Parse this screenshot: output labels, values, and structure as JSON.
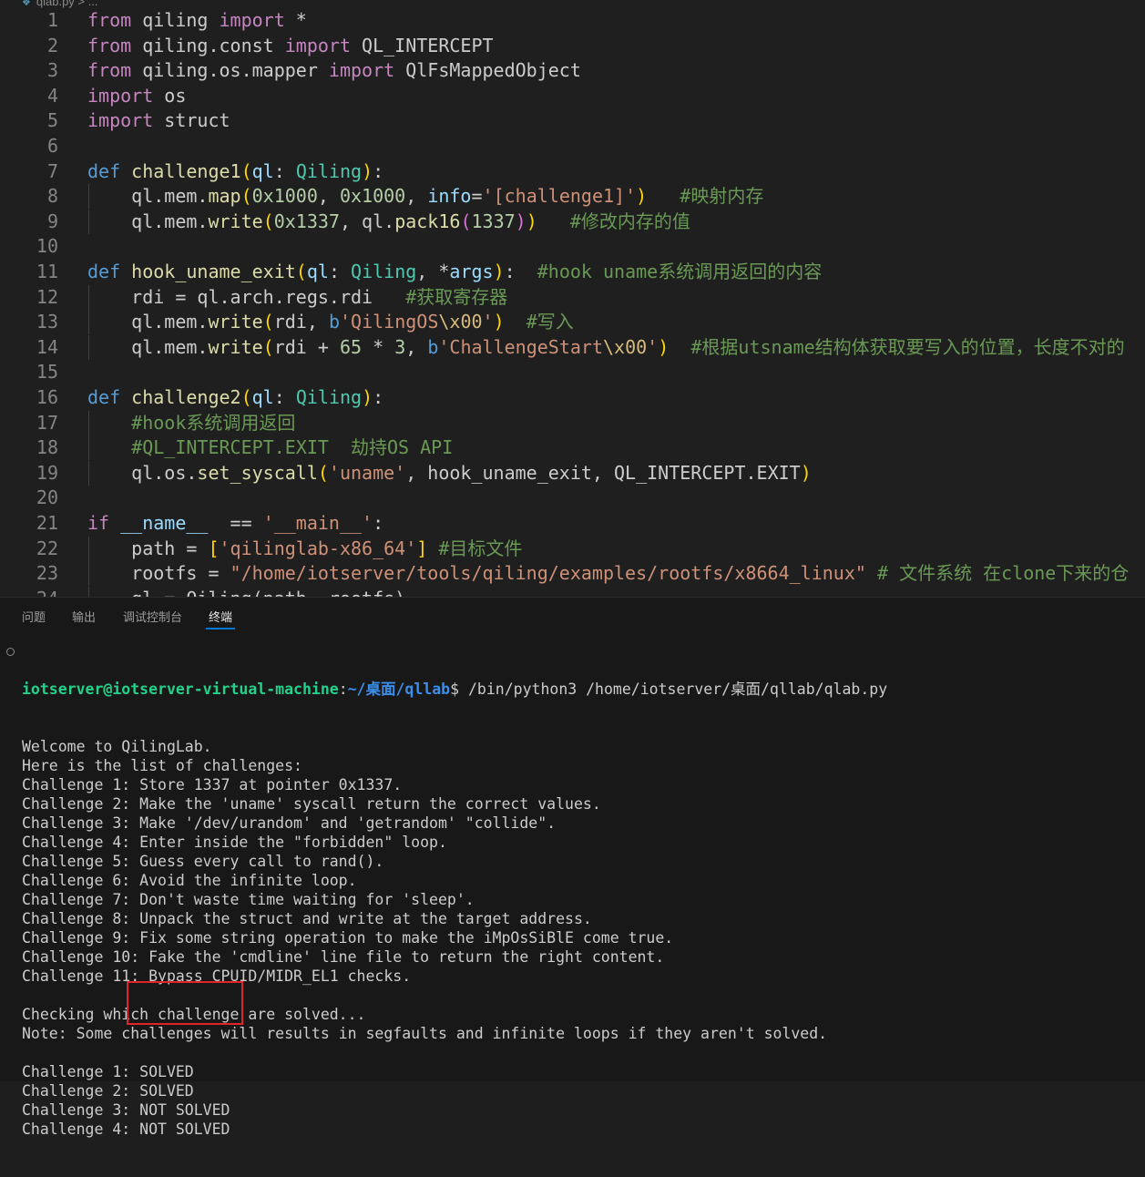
{
  "editor": {
    "breadcrumb": "qlab.py > ...",
    "lines": [
      {
        "n": "1",
        "tokens": [
          [
            "kw-ctrl",
            "from"
          ],
          [
            "txt",
            " qiling "
          ],
          [
            "kw-ctrl",
            "import"
          ],
          [
            "txt",
            " *"
          ]
        ]
      },
      {
        "n": "2",
        "tokens": [
          [
            "kw-ctrl",
            "from"
          ],
          [
            "txt",
            " qiling.const "
          ],
          [
            "kw-ctrl",
            "import"
          ],
          [
            "txt",
            " QL_INTERCEPT"
          ]
        ]
      },
      {
        "n": "3",
        "tokens": [
          [
            "kw-ctrl",
            "from"
          ],
          [
            "txt",
            " qiling.os.mapper "
          ],
          [
            "kw-ctrl",
            "import"
          ],
          [
            "txt",
            " QlFsMappedObject"
          ]
        ]
      },
      {
        "n": "4",
        "tokens": [
          [
            "kw-ctrl",
            "import"
          ],
          [
            "txt",
            " os"
          ]
        ]
      },
      {
        "n": "5",
        "tokens": [
          [
            "kw-ctrl",
            "import"
          ],
          [
            "txt",
            " struct"
          ]
        ]
      },
      {
        "n": "6",
        "tokens": []
      },
      {
        "n": "7",
        "tokens": [
          [
            "kw",
            "def"
          ],
          [
            "txt",
            " "
          ],
          [
            "fn",
            "challenge1"
          ],
          [
            "b1",
            "("
          ],
          [
            "var",
            "ql"
          ],
          [
            "txt",
            ": "
          ],
          [
            "cls",
            "Qiling"
          ],
          [
            "b1",
            ")"
          ],
          [
            "txt",
            ":"
          ]
        ]
      },
      {
        "n": "8",
        "indent": true,
        "tokens": [
          [
            "txt",
            "    ql.mem."
          ],
          [
            "fn",
            "map"
          ],
          [
            "b1",
            "("
          ],
          [
            "num",
            "0x1000"
          ],
          [
            "txt",
            ", "
          ],
          [
            "num",
            "0x1000"
          ],
          [
            "txt",
            ", "
          ],
          [
            "var",
            "info"
          ],
          [
            "txt",
            "="
          ],
          [
            "str",
            "'[challenge1]'"
          ],
          [
            "b1",
            ")"
          ],
          [
            "txt",
            "   "
          ],
          [
            "com",
            "#映射内存"
          ]
        ]
      },
      {
        "n": "9",
        "indent": true,
        "tokens": [
          [
            "txt",
            "    ql.mem."
          ],
          [
            "fn",
            "write"
          ],
          [
            "b1",
            "("
          ],
          [
            "num",
            "0x1337"
          ],
          [
            "txt",
            ", ql."
          ],
          [
            "fn",
            "pack16"
          ],
          [
            "b2",
            "("
          ],
          [
            "num",
            "1337"
          ],
          [
            "b2",
            ")"
          ],
          [
            "b1",
            ")"
          ],
          [
            "txt",
            "   "
          ],
          [
            "com",
            "#修改内存的值"
          ]
        ]
      },
      {
        "n": "10",
        "tokens": []
      },
      {
        "n": "11",
        "tokens": [
          [
            "kw",
            "def"
          ],
          [
            "txt",
            " "
          ],
          [
            "fn",
            "hook_uname_exit"
          ],
          [
            "b1",
            "("
          ],
          [
            "var",
            "ql"
          ],
          [
            "txt",
            ": "
          ],
          [
            "cls",
            "Qiling"
          ],
          [
            "txt",
            ", *"
          ],
          [
            "var",
            "args"
          ],
          [
            "b1",
            ")"
          ],
          [
            "txt",
            ":  "
          ],
          [
            "com",
            "#hook uname系统调用返回的内容"
          ]
        ]
      },
      {
        "n": "12",
        "indent": true,
        "tokens": [
          [
            "txt",
            "    rdi = ql.arch.regs.rdi   "
          ],
          [
            "com",
            "#获取寄存器"
          ]
        ]
      },
      {
        "n": "13",
        "indent": true,
        "tokens": [
          [
            "txt",
            "    ql.mem."
          ],
          [
            "fn",
            "write"
          ],
          [
            "b1",
            "("
          ],
          [
            "txt",
            "rdi, "
          ],
          [
            "kw",
            "b"
          ],
          [
            "str",
            "'QilingOS"
          ],
          [
            "esc",
            "\\x00"
          ],
          [
            "str",
            "'"
          ],
          [
            "b1",
            ")"
          ],
          [
            "txt",
            "  "
          ],
          [
            "com",
            "#写入"
          ]
        ]
      },
      {
        "n": "14",
        "indent": true,
        "tokens": [
          [
            "txt",
            "    ql.mem."
          ],
          [
            "fn",
            "write"
          ],
          [
            "b1",
            "("
          ],
          [
            "txt",
            "rdi + "
          ],
          [
            "num",
            "65"
          ],
          [
            "txt",
            " * "
          ],
          [
            "num",
            "3"
          ],
          [
            "txt",
            ", "
          ],
          [
            "kw",
            "b"
          ],
          [
            "str",
            "'ChallengeStart"
          ],
          [
            "esc",
            "\\x00"
          ],
          [
            "str",
            "'"
          ],
          [
            "b1",
            ")"
          ],
          [
            "txt",
            "  "
          ],
          [
            "com",
            "#根据utsname结构体获取要写入的位置，长度不对的"
          ]
        ]
      },
      {
        "n": "15",
        "tokens": []
      },
      {
        "n": "16",
        "tokens": [
          [
            "kw",
            "def"
          ],
          [
            "txt",
            " "
          ],
          [
            "fn",
            "challenge2"
          ],
          [
            "b1",
            "("
          ],
          [
            "var",
            "ql"
          ],
          [
            "txt",
            ": "
          ],
          [
            "cls",
            "Qiling"
          ],
          [
            "b1",
            ")"
          ],
          [
            "txt",
            ":"
          ]
        ]
      },
      {
        "n": "17",
        "indent": true,
        "tokens": [
          [
            "txt",
            "    "
          ],
          [
            "com",
            "#hook系统调用返回"
          ]
        ]
      },
      {
        "n": "18",
        "indent": true,
        "tokens": [
          [
            "txt",
            "    "
          ],
          [
            "com",
            "#QL_INTERCEPT.EXIT  劫持OS API"
          ]
        ]
      },
      {
        "n": "19",
        "indent": true,
        "tokens": [
          [
            "txt",
            "    ql.os."
          ],
          [
            "fn",
            "set_syscall"
          ],
          [
            "b1",
            "("
          ],
          [
            "str",
            "'uname'"
          ],
          [
            "txt",
            ", hook_uname_exit, QL_INTERCEPT.EXIT"
          ],
          [
            "b1",
            ")"
          ]
        ]
      },
      {
        "n": "20",
        "tokens": []
      },
      {
        "n": "21",
        "tokens": [
          [
            "kw-ctrl",
            "if"
          ],
          [
            "txt",
            " "
          ],
          [
            "var",
            "__name__"
          ],
          [
            "txt",
            "  == "
          ],
          [
            "str",
            "'__main__'"
          ],
          [
            "txt",
            ":"
          ]
        ]
      },
      {
        "n": "22",
        "indent": true,
        "tokens": [
          [
            "txt",
            "    path = "
          ],
          [
            "b1",
            "["
          ],
          [
            "str",
            "'qilinglab-x86_64'"
          ],
          [
            "b1",
            "]"
          ],
          [
            "txt",
            " "
          ],
          [
            "com",
            "#目标文件"
          ]
        ]
      },
      {
        "n": "23",
        "indent": true,
        "tokens": [
          [
            "txt",
            "    rootfs = "
          ],
          [
            "str",
            "\"/home/iotserver/tools/qiling/examples/rootfs/x8664_linux\""
          ],
          [
            "txt",
            " "
          ],
          [
            "com",
            "# 文件系统 在clone下来的仓"
          ]
        ]
      },
      {
        "n": "24",
        "indent": true,
        "tokens": [
          [
            "txt",
            "    ql = Qiling(path, rootfs)"
          ]
        ]
      }
    ]
  },
  "panel": {
    "tabs": [
      "问题",
      "输出",
      "调试控制台",
      "终端"
    ],
    "active_tab": "终端"
  },
  "terminal": {
    "prompt_user": "iotserver@iotserver-virtual-machine",
    "prompt_sep": ":",
    "prompt_path": "~/桌面/qllab",
    "prompt_cmd": "$ /bin/python3 /home/iotserver/桌面/qllab/qlab.py",
    "lines": [
      "Welcome to QilingLab.",
      "Here is the list of challenges:",
      "Challenge 1: Store 1337 at pointer 0x1337.",
      "Challenge 2: Make the 'uname' syscall return the correct values.",
      "Challenge 3: Make '/dev/urandom' and 'getrandom' \"collide\".",
      "Challenge 4: Enter inside the \"forbidden\" loop.",
      "Challenge 5: Guess every call to rand().",
      "Challenge 6: Avoid the infinite loop.",
      "Challenge 7: Don't waste time waiting for 'sleep'.",
      "Challenge 8: Unpack the struct and write at the target address.",
      "Challenge 9: Fix some string operation to make the iMpOsSiBlE come true.",
      "Challenge 10: Fake the 'cmdline' line file to return the right content.",
      "Challenge 11: Bypass CPUID/MIDR_EL1 checks.",
      "",
      "Checking which challenge are solved...",
      "Note: Some challenges will results in segfaults and infinite loops if they aren't solved.",
      "",
      "Challenge 1: SOLVED",
      "Challenge 2: SOLVED",
      "Challenge 3: NOT SOLVED",
      "Challenge 4: NOT SOLVED"
    ]
  },
  "colors": {
    "accent": "#0078d4",
    "highlight_box": "#e0242b",
    "prompt_user": "#23d18b",
    "prompt_path": "#3b8eea"
  }
}
